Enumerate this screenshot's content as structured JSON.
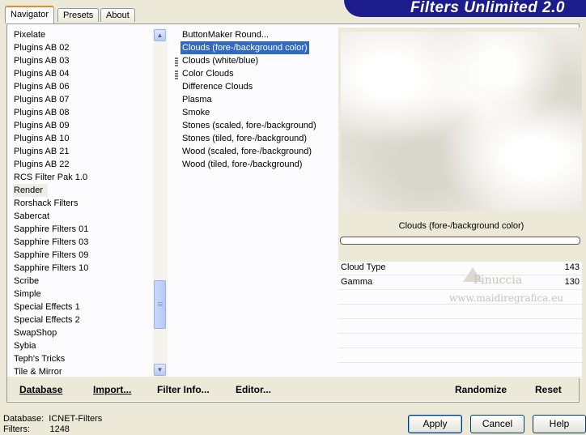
{
  "tabs": [
    "Navigator",
    "Presets",
    "About"
  ],
  "banner_title": "Filters Unlimited 2.0",
  "categories": [
    "Pixelate",
    "Plugins AB 02",
    "Plugins AB 03",
    "Plugins AB 04",
    "Plugins AB 06",
    "Plugins AB 07",
    "Plugins AB 08",
    "Plugins AB 09",
    "Plugins AB 10",
    "Plugins AB 21",
    "Plugins AB 22",
    "RCS Filter Pak 1.0",
    "Render",
    "Rorshack Filters",
    "Sabercat",
    "Sapphire Filters 01",
    "Sapphire Filters 03",
    "Sapphire Filters 09",
    "Sapphire Filters 10",
    "Scribe",
    "Simple",
    "Special Effects 1",
    "Special Effects 2",
    "SwapShop",
    "Sybia",
    "Teph's Tricks",
    "Tile & Mirror"
  ],
  "selected_category": "Render",
  "filters": [
    "ButtonMaker Round...",
    "Clouds (fore-/background color)",
    "Clouds (white/blue)",
    "Color Clouds",
    "Difference Clouds",
    "Plasma",
    "Smoke",
    "Stones (scaled, fore-/background)",
    "Stones (tiled, fore-/background)",
    "Wood (scaled, fore-/background)",
    "Wood (tiled, fore-/background)"
  ],
  "selected_filter": "Clouds (fore-/background color)",
  "preview_title": "Clouds (fore-/background color)",
  "parameters": [
    {
      "name": "Cloud Type",
      "value": "143"
    },
    {
      "name": "Gamma",
      "value": "130"
    }
  ],
  "watermark": {
    "line1": "Pinuccia",
    "line2": "www.maidiregrafica.eu"
  },
  "bottom_links": {
    "database": "Database",
    "import": "Import...",
    "filter_info": "Filter Info...",
    "editor": "Editor...",
    "randomize": "Randomize",
    "reset": "Reset"
  },
  "footer": {
    "database_label": "Database:",
    "database_value": "ICNET-Filters",
    "filters_label": "Filters:",
    "filters_value": "1248"
  },
  "buttons": {
    "apply": "Apply",
    "cancel": "Cancel",
    "help": "Help"
  },
  "colors": {
    "banner": "#1c1c8c",
    "selection": "#316ac5",
    "dialog_bg": "#ece9d8"
  }
}
